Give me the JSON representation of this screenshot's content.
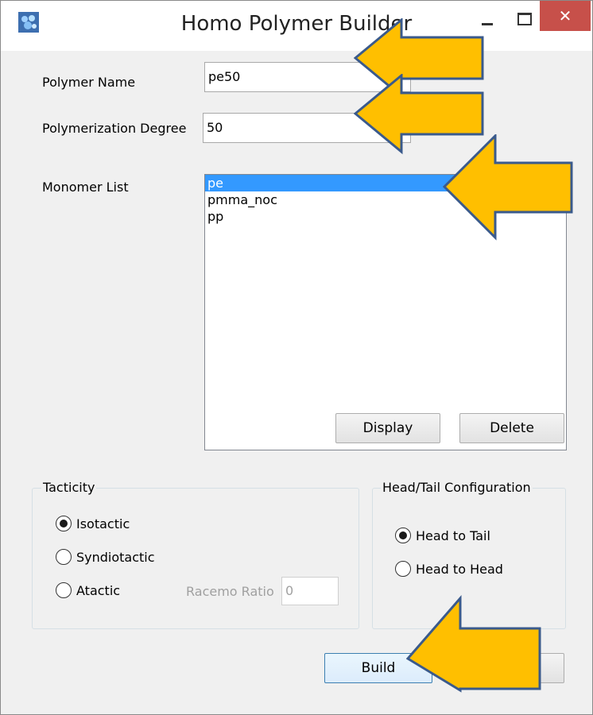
{
  "window": {
    "title": "Homo Polymer Builder",
    "close_glyph": "✕"
  },
  "fields": {
    "polymer_name_label": "Polymer Name",
    "polymer_name_value": "pe50",
    "degree_label": "Polymerization Degree",
    "degree_value": "50"
  },
  "monomer": {
    "label": "Monomer List",
    "items": [
      "pe",
      "pmma_noc",
      "pp"
    ],
    "selected": "pe",
    "display_button": "Display",
    "delete_button": "Delete"
  },
  "tacticity": {
    "title": "Tacticity",
    "options": [
      "Isotactic",
      "Syndiotactic",
      "Atactic"
    ],
    "selected": "Isotactic",
    "racemo_label": "Racemo Ratio",
    "racemo_value": "0"
  },
  "headtail": {
    "title": "Head/Tail Configuration",
    "options": [
      "Head to Tail",
      "Head to Head"
    ],
    "selected": "Head to Tail"
  },
  "actions": {
    "build_button": "Build"
  },
  "colors": {
    "arrow_fill": "#ffbf00",
    "arrow_stroke": "#3a5a8c",
    "selection": "#3399ff",
    "close_button": "#c7504a"
  }
}
